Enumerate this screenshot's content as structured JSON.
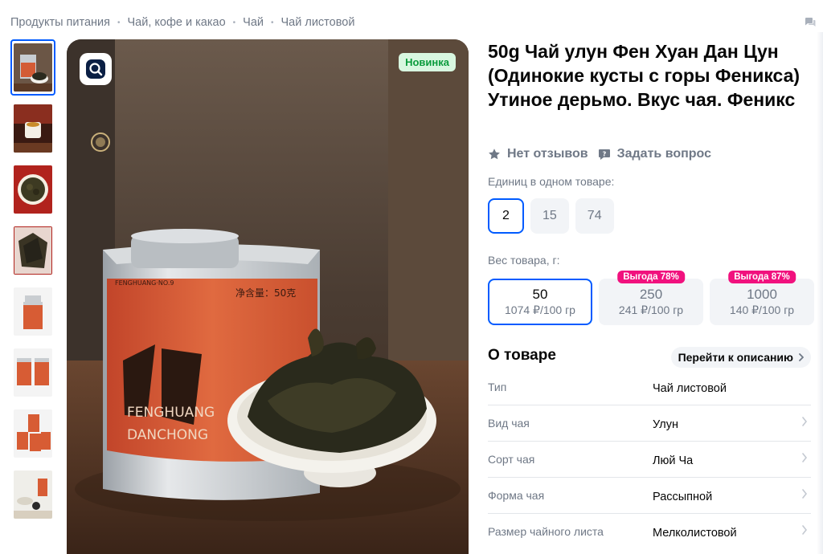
{
  "breadcrumb": [
    "Продукты питания",
    "Чай, кофе и какао",
    "Чай",
    "Чай листовой"
  ],
  "gallery": {
    "badge_new": "Новинка",
    "thumbnail_count": 8
  },
  "product": {
    "title": "50g Чай улун Фен Хуан Дан Цун (Одинокие кусты с горы Феникса) Утиное дерьмо. Вкус чая. Феникс",
    "reviews": "Нет отзывов",
    "ask_question": "Задать вопрос"
  },
  "units": {
    "label": "Единиц в одном товаре:",
    "options": [
      "2",
      "15",
      "74"
    ],
    "selected": "2"
  },
  "weight": {
    "label": "Вес товара, г:",
    "options": [
      {
        "weight": "50",
        "price": "1074 ₽/100 гр",
        "sale": ""
      },
      {
        "weight": "250",
        "price": "241 ₽/100 гр",
        "sale": "Выгода 78%"
      },
      {
        "weight": "1000",
        "price": "140 ₽/100 гр",
        "sale": "Выгода 87%"
      }
    ],
    "selected": "50"
  },
  "about": {
    "heading": "О товаре",
    "goto_label": "Перейти к описанию",
    "specs": [
      {
        "key": "Тип",
        "value": "Чай листовой",
        "link": false
      },
      {
        "key": "Вид чая",
        "value": "Улун",
        "link": true
      },
      {
        "key": "Сорт чая",
        "value": "Люй Ча",
        "link": true
      },
      {
        "key": "Форма чая",
        "value": "Рассыпной",
        "link": true
      },
      {
        "key": "Размер чайного листа",
        "value": "Мелколистовой",
        "link": true
      }
    ]
  },
  "colors": {
    "accent": "#005bff",
    "sale": "#f1117e",
    "new_badge_bg": "#d8f7e0",
    "new_badge_text": "#0a9b3c",
    "muted_text": "#6f7886"
  }
}
